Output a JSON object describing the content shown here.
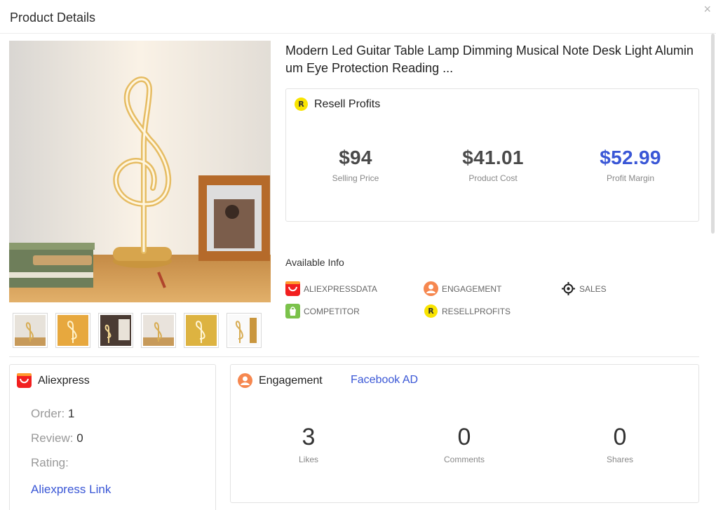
{
  "header": {
    "title": "Product Details",
    "close_glyph": "×"
  },
  "product": {
    "title": "Modern Led Guitar Table Lamp Dimming Musical Note Desk Light Aluminum Eye Protection Reading ...",
    "thumbnails": [
      "thumb-1",
      "thumb-2",
      "thumb-3",
      "thumb-4",
      "thumb-5",
      "thumb-6"
    ]
  },
  "resell": {
    "heading": "Resell Profits",
    "badge": "R",
    "selling_price": "$94",
    "selling_price_label": "Selling Price",
    "product_cost": "$41.01",
    "product_cost_label": "Product Cost",
    "profit_margin": "$52.99",
    "profit_margin_label": "Profit Margin",
    "margin_color": "#3a57d6"
  },
  "available_info": {
    "title": "Available Info",
    "items": [
      {
        "label": "ALIEXPRESSDATA",
        "icon": "aliexpress-icon"
      },
      {
        "label": "ENGAGEMENT",
        "icon": "engagement-icon"
      },
      {
        "label": "SALES",
        "icon": "crosshair-icon"
      },
      {
        "label": "COMPETITOR",
        "icon": "shopify-icon"
      },
      {
        "label": "RESELLPROFITS",
        "icon": "resell-badge-icon"
      }
    ]
  },
  "aliexpress": {
    "heading": "Aliexpress",
    "order_label": "Order:",
    "order_value": "1",
    "review_label": "Review:",
    "review_value": "0",
    "rating_label": "Rating:",
    "link": "Aliexpress Link"
  },
  "engagement": {
    "heading": "Engagement",
    "fb_link": "Facebook AD",
    "likes": "3",
    "likes_label": "Likes",
    "comments": "0",
    "comments_label": "Comments",
    "shares": "0",
    "shares_label": "Shares"
  },
  "colors": {
    "accent": "#3a57d6",
    "aliexpress_red": "#f21f1f",
    "engagement_orange": "#f6874f",
    "badge_yellow": "#f9e400",
    "shopify_green": "#7bc24b"
  }
}
